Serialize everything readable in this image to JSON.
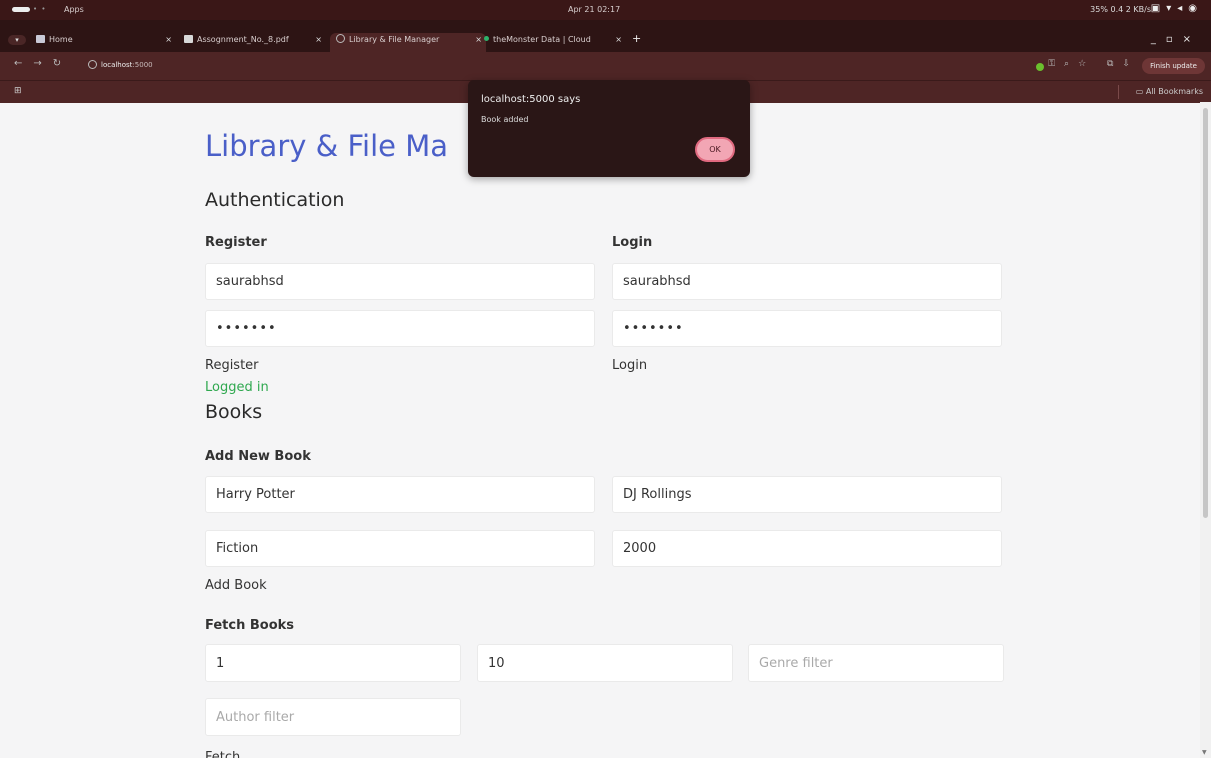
{
  "system": {
    "apps": "Apps",
    "clock": "Apr 21 02:17",
    "status": "35%  0.4  2 KB/s"
  },
  "browser": {
    "tabs": [
      {
        "title": "Home"
      },
      {
        "title": "Assognment_No._8.pdf"
      },
      {
        "title": "Library & File Manager"
      },
      {
        "title": "theMonster Data | Cloud"
      }
    ],
    "url_host": "localhost",
    "url_port": ":5000",
    "finish_update": "Finish update",
    "all_bookmarks": "All Bookmarks"
  },
  "page": {
    "title": "Library & File Ma",
    "auth_heading": "Authentication",
    "register": {
      "heading": "Register",
      "username": "saurabhsd",
      "password": "saurabh",
      "button": "Register"
    },
    "login": {
      "heading": "Login",
      "username": "saurabhsd",
      "password": "saurabh",
      "button": "Login"
    },
    "status": "Logged in",
    "books_heading": "Books",
    "add_book": {
      "heading": "Add New Book",
      "title": "Harry Potter",
      "author": "DJ Rollings",
      "genre": "Fiction",
      "year": "2000",
      "button": "Add Book"
    },
    "fetch": {
      "heading": "Fetch Books",
      "page": "1",
      "limit": "10",
      "genre_placeholder": "Genre filter",
      "author_placeholder": "Author filter",
      "button": "Fetch"
    }
  },
  "dialog": {
    "title": "localhost:5000 says",
    "message": "Book added",
    "ok": "OK"
  }
}
